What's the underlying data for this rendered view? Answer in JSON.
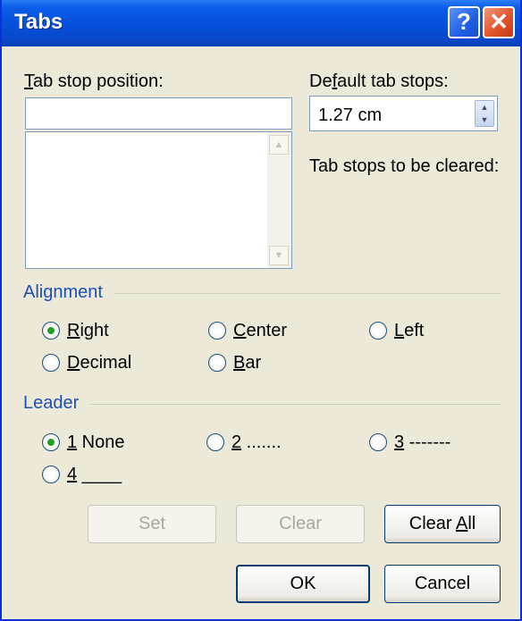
{
  "window": {
    "title": "Tabs",
    "help_symbol": "?",
    "close_symbol": "✕"
  },
  "tab_stop_position": {
    "label_mnemonic": "T",
    "label_rest": "ab stop position:",
    "value": ""
  },
  "default_tab_stops": {
    "label_before": "De",
    "label_mnemonic": "f",
    "label_after": "ault tab stops:",
    "value": "1.27 cm"
  },
  "tab_stops_cleared": {
    "label": "Tab stops to be cleared:"
  },
  "alignment": {
    "header": "Alignment",
    "options": [
      {
        "mnemonic": "R",
        "rest": "ight",
        "checked": true
      },
      {
        "mnemonic": "C",
        "rest": "enter",
        "checked": false
      },
      {
        "mnemonic": "L",
        "rest": "eft",
        "checked": false
      },
      {
        "mnemonic": "D",
        "rest": "ecimal",
        "checked": false
      },
      {
        "mnemonic": "B",
        "rest": "ar",
        "checked": false
      }
    ]
  },
  "leader": {
    "header": "Leader",
    "options": [
      {
        "mnemonic": "1",
        "rest": " None",
        "checked": true
      },
      {
        "mnemonic": "2",
        "rest": " .......",
        "checked": false
      },
      {
        "mnemonic": "3",
        "rest": " -------",
        "checked": false
      },
      {
        "mnemonic": "4",
        "rest": " ____",
        "checked": false
      }
    ]
  },
  "buttons": {
    "set": "Set",
    "clear": "Clear",
    "clear_all_before": "Clear ",
    "clear_all_mnemonic": "A",
    "clear_all_after": "ll",
    "ok": "OK",
    "cancel": "Cancel"
  },
  "colors": {
    "title_bar": "#0550db",
    "dialog_bg": "#ece9d8",
    "group_header": "#1e4fb4",
    "radio_dot": "#21a121",
    "close_button": "#e2542c"
  }
}
